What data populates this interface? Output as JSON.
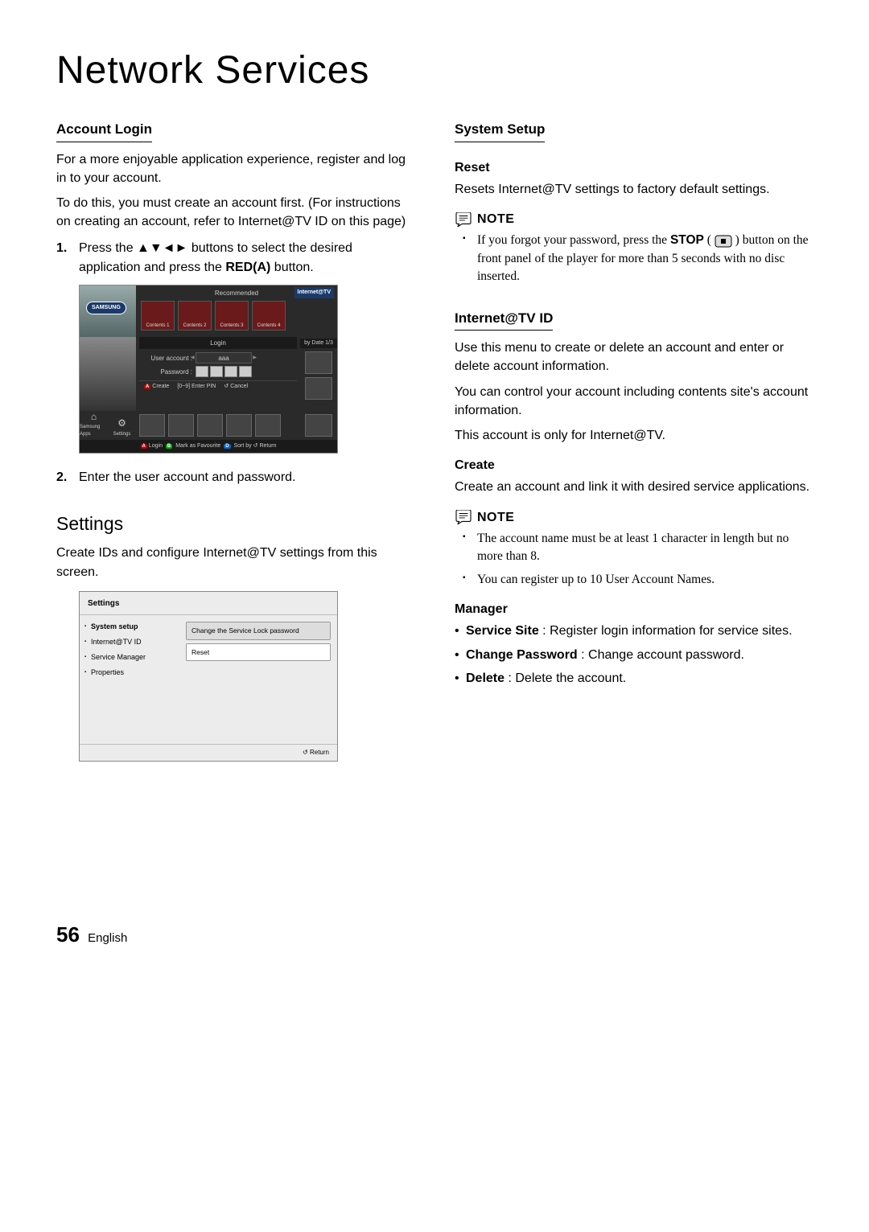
{
  "page_title": "Network Services",
  "left": {
    "h_account": "Account Login",
    "p1": "For a more enjoyable application experience, register and log in to your account.",
    "p2": "To do this, you must create an account first. (For instructions on creating an account, refer to Internet@TV ID on this page)",
    "step1_pre": "Press the ",
    "step1_arrows": "▲▼◄►",
    "step1_mid": " buttons to select the desired application and press the ",
    "step1_red": "RED(A)",
    "step1_post": " button.",
    "step2": "Enter the user account and password.",
    "h_settings": "Settings",
    "p_settings": "Create IDs and configure Internet@TV settings from this screen."
  },
  "fig1": {
    "brand": "SAMSUNG",
    "iat": "Internet@TV",
    "rec_title": "Recommended",
    "tiles": [
      "Contents 1",
      "Contents 2",
      "Contents 3",
      "Contents 4"
    ],
    "login_title": "Login",
    "ua_label": "User account :",
    "ua_value": "aaa",
    "pw_label": "Password :",
    "opt_create": "Create",
    "opt_pin": "[0~9] Enter PIN",
    "opt_cancel": "Cancel",
    "bydate": "by Date 1/3",
    "app1": "Samsung Apps",
    "app2": "Settings",
    "footer_login": "Login",
    "footer_fav": "Mark as Favourite",
    "footer_sort": "Sort by",
    "footer_return": "Return"
  },
  "fig2": {
    "title": "Settings",
    "side": [
      "System setup",
      "Internet@TV ID",
      "Service Manager",
      "Properties"
    ],
    "row1": "Change the Service Lock password",
    "row2": "Reset",
    "footer": "Return"
  },
  "right": {
    "h_system": "System Setup",
    "h_reset": "Reset",
    "p_reset": "Resets Internet@TV settings to factory default settings.",
    "note1_pre": "If you forgot your password, press the ",
    "note1_stop": "STOP",
    "note1_post": " button on the front panel of the player for more than 5 seconds with no disc inserted.",
    "h_iatid": "Internet@TV ID",
    "p_iat1": "Use this menu to create or delete an account and enter or delete account information.",
    "p_iat2": "You can control your account including contents site's account information.",
    "p_iat3": "This account is only for Internet@TV.",
    "h_create": "Create",
    "p_create": "Create an account and link it with desired service applications.",
    "note2a": "The account name must be at least 1 character in length but no more than 8.",
    "note2b": "You can register up to 10 User Account Names.",
    "h_manager": "Manager",
    "mgr1_b": "Service Site",
    "mgr1_t": " : Register login information for service sites.",
    "mgr2_b": "Change Password",
    "mgr2_t": " : Change account password.",
    "mgr3_b": "Delete",
    "mgr3_t": " : Delete the account."
  },
  "note_label": "NOTE",
  "footer": {
    "num": "56",
    "lang": "English"
  }
}
